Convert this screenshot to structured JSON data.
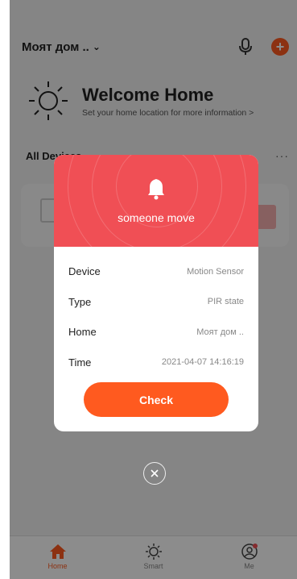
{
  "header": {
    "home_name": "Моят дом ..",
    "chevron_glyph": "⌄",
    "add_glyph": "+",
    "colors": {
      "accent": "#ff5a1f"
    }
  },
  "welcome": {
    "title": "Welcome Home",
    "subtitle": "Set your home location for more information >"
  },
  "devices": {
    "title": "All Devices",
    "more_glyph": "···"
  },
  "tabbar": {
    "items": [
      {
        "label": "Home",
        "icon": "home-icon",
        "active": true
      },
      {
        "label": "Smart",
        "icon": "sun-icon",
        "active": false
      },
      {
        "label": "Me",
        "icon": "profile-icon",
        "active": false
      }
    ]
  },
  "alert": {
    "message": "someone move",
    "header_color": "#f04f55",
    "rows": [
      {
        "label": "Device",
        "value": "Motion Sensor"
      },
      {
        "label": "Type",
        "value": "PIR state"
      },
      {
        "label": "Home",
        "value": "Моят дом .."
      },
      {
        "label": "Time",
        "value": "2021-04-07 14:16:19"
      }
    ],
    "check_label": "Check",
    "close_icon": "close-icon"
  }
}
